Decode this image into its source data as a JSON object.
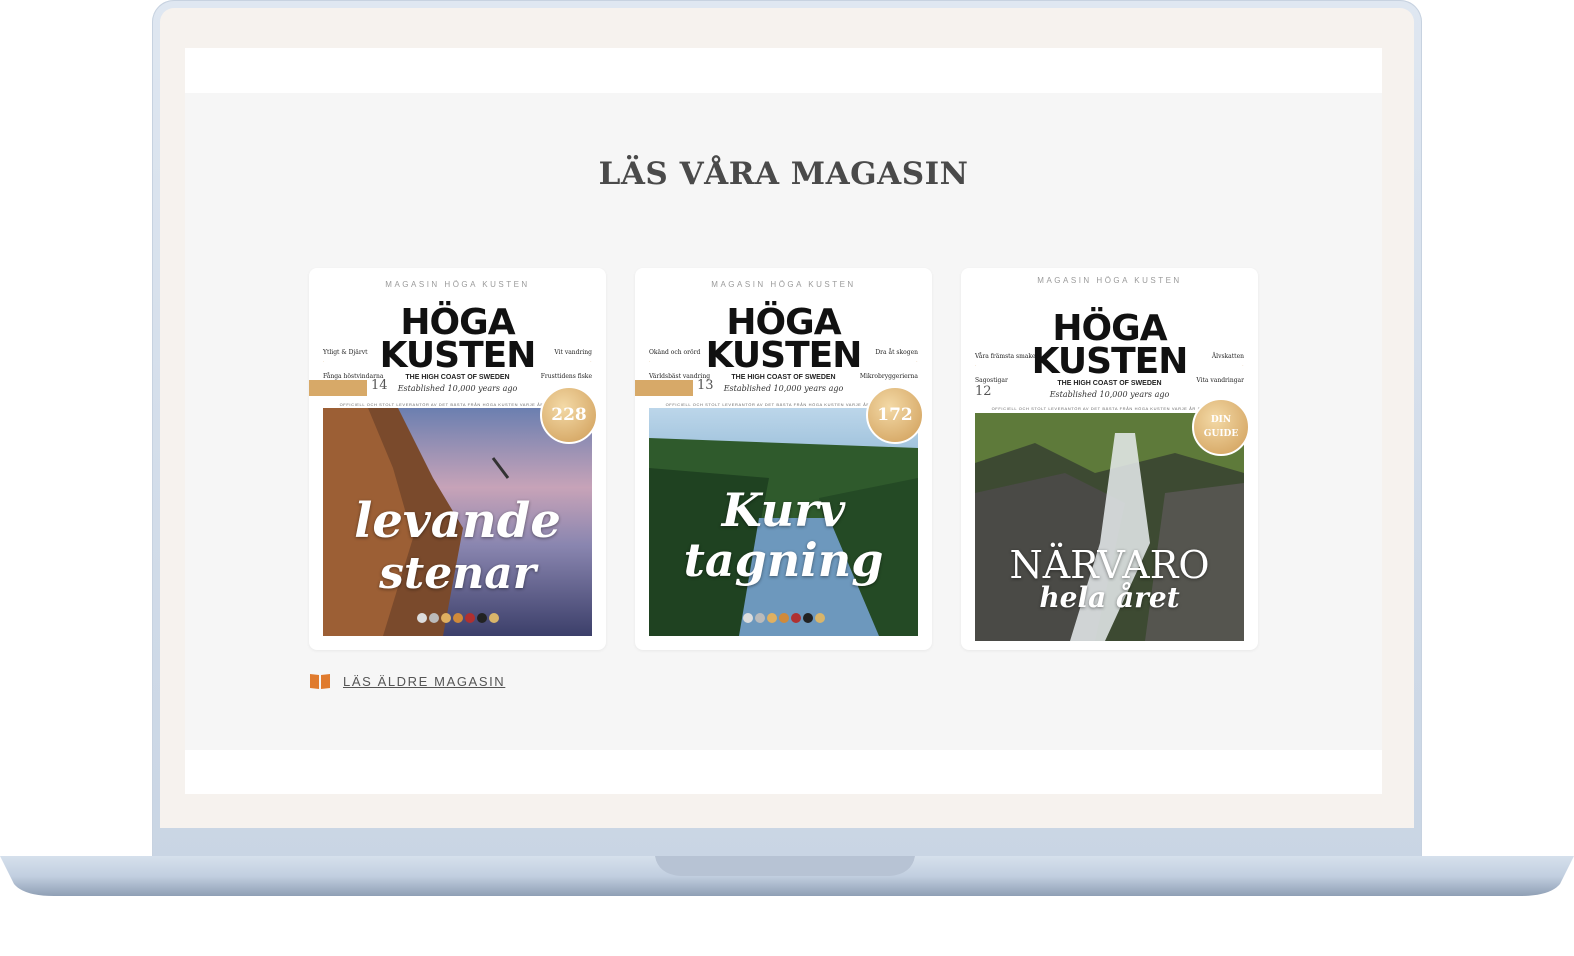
{
  "section": {
    "title": "LÄS VÅRA MAGASIN"
  },
  "magazines": [
    {
      "header": "MAGASIN HÖGA KUSTEN",
      "logo_line1": "HÖGA",
      "logo_line2": "KUSTEN",
      "subtitle": "THE HIGH COAST OF SWEDEN",
      "established": "Established 10,000 years ago",
      "left_items": [
        "Ytligt & Djärvt",
        "Fånga höstvindarna"
      ],
      "right_items": [
        "Vit vandring",
        "Frusttidens fiske"
      ],
      "issue": "14",
      "badge": "228",
      "tagline": "OFFICIELL OCH STOLT LEVERANTÖR AV DET BÄSTA FRÅN HÖGA KUSTEN VARJE ÅR SEDAN 2009",
      "cover_title_1": "levande",
      "cover_title_2": "stenar"
    },
    {
      "header": "MAGASIN HÖGA KUSTEN",
      "logo_line1": "HÖGA",
      "logo_line2": "KUSTEN",
      "subtitle": "THE HIGH COAST OF SWEDEN",
      "established": "Established 10,000 years ago",
      "left_items": [
        "Okänd och orörd",
        "Världsbäst vandring"
      ],
      "right_items": [
        "Dra åt skogen",
        "Mikrobryggerierna"
      ],
      "issue": "13",
      "badge": "172",
      "tagline": "OFFICIELL OCH STOLT LEVERANTÖR AV DET BÄSTA FRÅN HÖGA KUSTEN VARJE ÅR SEDAN 2009",
      "cover_title_1": "Kurv",
      "cover_title_2": "tagning"
    },
    {
      "header": "MAGASIN HÖGA KUSTEN",
      "logo_line1": "HÖGA",
      "logo_line2": "KUSTEN",
      "subtitle": "THE HIGH COAST OF SWEDEN",
      "established": "Established 10,000 years ago",
      "left_items": [
        "Våra främsta smaker",
        "Sagostigar"
      ],
      "right_items": [
        "Älvskatten",
        "Vita vandringar"
      ],
      "issue": "12",
      "badge": "DIN GUIDE",
      "tagline": "OFFICIELL OCH STOLT LEVERANTÖR AV DET BÄSTA FRÅN HÖGA KUSTEN VARJE ÅR SEDAN 2009",
      "cover_title_1": "NÄRVARO",
      "cover_title_2": "hela året"
    }
  ],
  "older_link": {
    "icon": "book-icon",
    "label": "LÄS ÄLDRE MAGASIN"
  },
  "colors": {
    "accent": "#e07b2e",
    "title": "#4a4a4a",
    "gold": "#d7a968"
  }
}
